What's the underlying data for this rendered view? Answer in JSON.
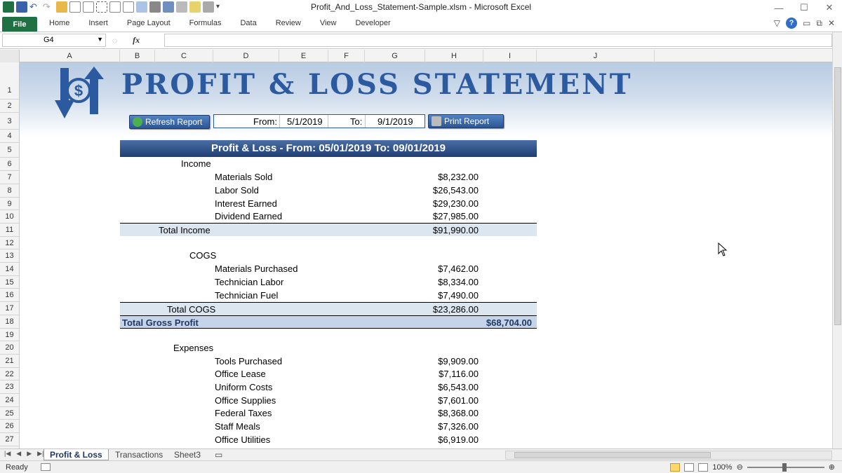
{
  "window": {
    "title": "Profit_And_Loss_Statement-Sample.xlsm  -  Microsoft Excel"
  },
  "ribbon": {
    "file_label": "File",
    "tabs": [
      "Home",
      "Insert",
      "Page Layout",
      "Formulas",
      "Data",
      "Review",
      "View",
      "Developer"
    ]
  },
  "formula_bar": {
    "name_box": "G4",
    "fx_label": "fx",
    "formula": ""
  },
  "columns": [
    "A",
    "B",
    "C",
    "D",
    "E",
    "F",
    "G",
    "H",
    "I",
    "J"
  ],
  "rows": [
    "1",
    "2",
    "3",
    "4",
    "5",
    "6",
    "7",
    "8",
    "9",
    "10",
    "11",
    "12",
    "13",
    "14",
    "15",
    "16",
    "17",
    "18",
    "19",
    "20",
    "21",
    "22",
    "23",
    "24",
    "25",
    "26",
    "27"
  ],
  "report": {
    "title": "PROFIT & LOSS STATEMENT",
    "refresh_label": "Refresh Report",
    "print_label": "Print Report",
    "from_label": "From:",
    "from_value": "5/1/2019",
    "to_label": "To:",
    "to_value": "9/1/2019",
    "header": "Profit & Loss - From: 05/01/2019 To: 09/01/2019",
    "income_label": "Income",
    "income_items": [
      {
        "name": "Materials Sold",
        "value": "$8,232.00"
      },
      {
        "name": "Labor Sold",
        "value": "$26,543.00"
      },
      {
        "name": "Interest Earned",
        "value": "$29,230.00"
      },
      {
        "name": "Dividend Earned",
        "value": "$27,985.00"
      }
    ],
    "total_income_label": "Total Income",
    "total_income_value": "$91,990.00",
    "cogs_label": "COGS",
    "cogs_items": [
      {
        "name": "Materials Purchased",
        "value": "$7,462.00"
      },
      {
        "name": "Technician Labor",
        "value": "$8,334.00"
      },
      {
        "name": "Technician Fuel",
        "value": "$7,490.00"
      }
    ],
    "total_cogs_label": "Total COGS",
    "total_cogs_value": "$23,286.00",
    "gross_label": "Total Gross Profit",
    "gross_value": "$68,704.00",
    "expenses_label": "Expenses",
    "expense_items": [
      {
        "name": "Tools Purchased",
        "value": "$9,909.00"
      },
      {
        "name": "Office Lease",
        "value": "$7,116.00"
      },
      {
        "name": "Uniform Costs",
        "value": "$6,543.00"
      },
      {
        "name": "Office Supplies",
        "value": "$7,601.00"
      },
      {
        "name": "Federal Taxes",
        "value": "$8,368.00"
      },
      {
        "name": "Staff Meals",
        "value": "$7,326.00"
      },
      {
        "name": "Office Utilities",
        "value": "$6,919.00"
      }
    ]
  },
  "sheet_tabs": [
    "Profit & Loss",
    "Transactions",
    "Sheet3"
  ],
  "status": {
    "ready": "Ready",
    "zoom": "100%"
  },
  "colors": {
    "excel_green": "#1f7144",
    "title_blue": "#2c5aa0",
    "header_navy": "#1f3e73",
    "band": "#dce6f1"
  }
}
